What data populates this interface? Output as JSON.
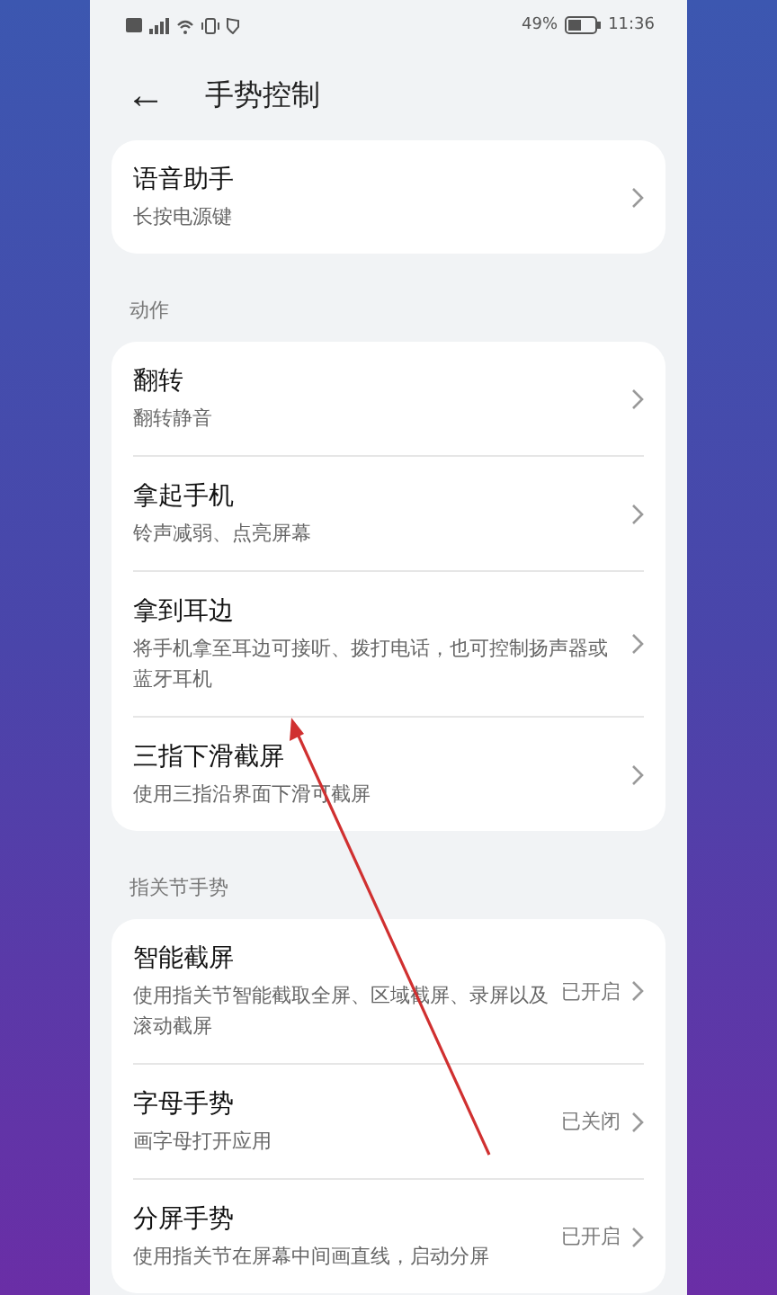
{
  "status_bar": {
    "battery": "49%",
    "time": "11:36"
  },
  "header": {
    "back": "←",
    "title": "手势控制"
  },
  "sections": [
    {
      "items": [
        {
          "title": "语音助手",
          "subtitle": "长按电源键"
        }
      ]
    },
    {
      "label": "动作",
      "items": [
        {
          "title": "翻转",
          "subtitle": "翻转静音"
        },
        {
          "title": "拿起手机",
          "subtitle": "铃声减弱、点亮屏幕"
        },
        {
          "title": "拿到耳边",
          "subtitle": "将手机拿至耳边可接听、拨打电话，也可控制扬声器或蓝牙耳机"
        },
        {
          "title": "三指下滑截屏",
          "subtitle": "使用三指沿界面下滑可截屏"
        }
      ]
    },
    {
      "label": "指关节手势",
      "items": [
        {
          "title": "智能截屏",
          "subtitle": "使用指关节智能截取全屏、区域截屏、录屏以及滚动截屏",
          "status": "已开启"
        },
        {
          "title": "字母手势",
          "subtitle": "画字母打开应用",
          "status": "已关闭"
        },
        {
          "title": "分屏手势",
          "subtitle": "使用指关节在屏幕中间画直线，启动分屏",
          "status": "已开启"
        }
      ]
    }
  ]
}
